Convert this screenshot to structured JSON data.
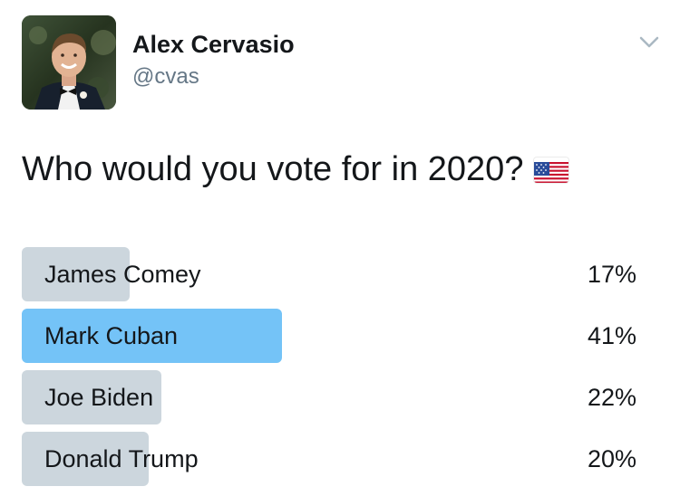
{
  "author": {
    "name": "Alex Cervasio",
    "handle": "@cvas",
    "avatar_icon": "profile-photo"
  },
  "menu": {
    "icon": "chevron-down-icon"
  },
  "tweet": {
    "text": "Who would you vote for in 2020?",
    "emoji": "us-flag-icon"
  },
  "poll": {
    "options": [
      {
        "label": "James Comey",
        "percent": "17%",
        "fraction": 0.17,
        "winner": false
      },
      {
        "label": "Mark Cuban",
        "percent": "41%",
        "fraction": 0.41,
        "winner": true
      },
      {
        "label": "Joe Biden",
        "percent": "22%",
        "fraction": 0.22,
        "winner": false
      },
      {
        "label": "Donald Trump",
        "percent": "20%",
        "fraction": 0.2,
        "winner": false
      }
    ]
  },
  "colors": {
    "bar": "#ccd6dd",
    "winner_bar": "#74c3f7",
    "handle": "#657786",
    "text": "#14171a"
  }
}
